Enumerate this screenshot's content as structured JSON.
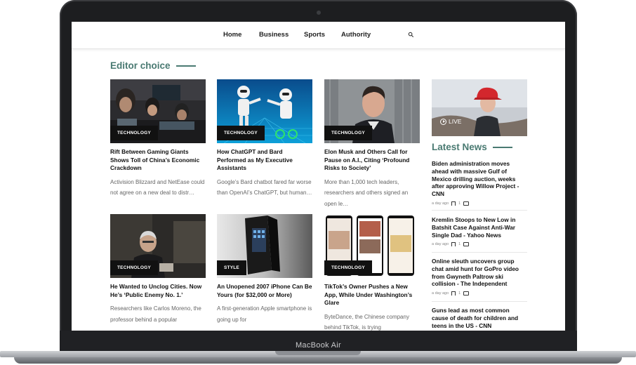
{
  "device": {
    "model_name": "MacBook Air"
  },
  "site": {
    "cut_text": "",
    "nav": {
      "items": [
        "Home",
        "Business",
        "Sports",
        "Authority"
      ]
    },
    "editor_choice": {
      "title": "Editor choice",
      "cards": [
        {
          "category": "TECHNOLOGY",
          "title": "Rift Between Gaming Giants Shows Toll of China’s Economic Crackdown",
          "excerpt": "Activision Blizzard and NetEase could not agree on a new deal to distr…"
        },
        {
          "category": "TECHNOLOGY",
          "title": "How ChatGPT and Bard Performed as My Executive Assistants",
          "excerpt": "Google’s Bard chatbot fared far worse than OpenAI’s ChatGPT, but human…"
        },
        {
          "category": "TECHNOLOGY",
          "title": "Elon Musk and Others Call for Pause on A.I., Citing ‘Profound Risks to Society’",
          "excerpt": "More than 1,000 tech leaders, researchers and others signed an open le…"
        },
        {
          "category": "TECHNOLOGY",
          "title": "He Wanted to Unclog Cities. Now He’s ‘Public Enemy No. 1.’",
          "excerpt": "Researchers like Carlos Moreno, the professor behind a popular"
        },
        {
          "category": "STYLE",
          "title": "An Unopened 2007 iPhone Can Be Yours (for $32,000 or More)",
          "excerpt": "A first-generation Apple smartphone is going up for"
        },
        {
          "category": "TECHNOLOGY",
          "title": "TikTok’s Owner Pushes a New App, While Under Washington’s Glare",
          "excerpt": "ByteDance, the Chinese company behind TikTok, is trying"
        }
      ]
    },
    "sidebar": {
      "live_label": "LIVE",
      "latest_title": "Latest News",
      "news": [
        {
          "title": "Biden administration moves ahead with massive Gulf of Mexico drilling auction, weeks after approving Willow Project - CNN",
          "time": "a day ago",
          "comments": "1"
        },
        {
          "title": "Kremlin Stoops to New Low in Batshit Case Against Anti-War Single Dad - Yahoo News",
          "time": "a day ago",
          "comments": "1"
        },
        {
          "title": "Online sleuth uncovers group chat amid hunt for GoPro video from Gwyneth Paltrow ski collision - The Independent",
          "time": "a day ago",
          "comments": "1"
        },
        {
          "title": "Guns lead as most common cause of death for children and teens in the US - CNN",
          "time": "",
          "comments": ""
        }
      ]
    }
  }
}
